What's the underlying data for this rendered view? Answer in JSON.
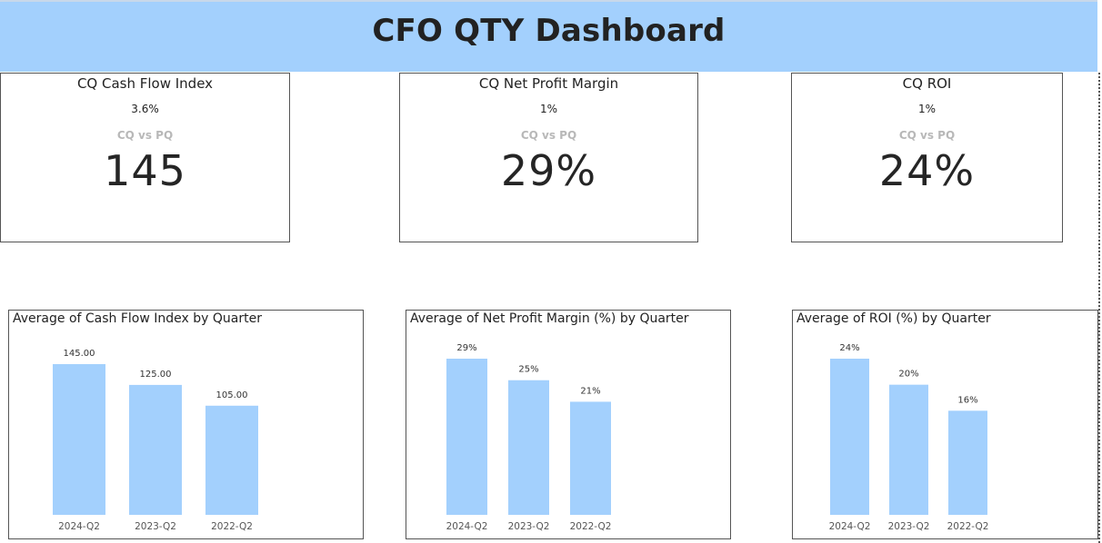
{
  "header": {
    "title": "CFO QTY Dashboard",
    "background": "#a3d0fd"
  },
  "kpis": [
    {
      "title": "CQ Cash Flow Index",
      "delta": "3.6%",
      "subtitle": "CQ vs PQ",
      "value": "145"
    },
    {
      "title": "CQ Net Profit Margin",
      "delta": "1%",
      "subtitle": "CQ vs PQ",
      "value": "29%"
    },
    {
      "title": "CQ ROI",
      "delta": "1%",
      "subtitle": "CQ vs PQ",
      "value": "24%"
    }
  ],
  "chart_data": [
    {
      "type": "bar",
      "title": "Average of Cash Flow Index by Quarter",
      "categories": [
        "2024-Q2",
        "2023-Q2",
        "2022-Q2"
      ],
      "values": [
        145,
        125,
        105
      ],
      "data_labels": [
        "145.00",
        "125.00",
        "105.00"
      ],
      "ylim": [
        0,
        145
      ],
      "bar_color": "#a3d0fd"
    },
    {
      "type": "bar",
      "title": "Average of Net Profit Margin (%) by Quarter",
      "categories": [
        "2024-Q2",
        "2023-Q2",
        "2022-Q2"
      ],
      "values": [
        29,
        25,
        21
      ],
      "data_labels": [
        "29%",
        "25%",
        "21%"
      ],
      "ylim": [
        0,
        29
      ],
      "bar_color": "#a3d0fd"
    },
    {
      "type": "bar",
      "title": "Average of ROI (%) by Quarter",
      "categories": [
        "2024-Q2",
        "2023-Q2",
        "2022-Q2"
      ],
      "values": [
        24,
        20,
        16
      ],
      "data_labels": [
        "24%",
        "20%",
        "16%"
      ],
      "ylim": [
        0,
        24
      ],
      "bar_color": "#a3d0fd"
    }
  ]
}
